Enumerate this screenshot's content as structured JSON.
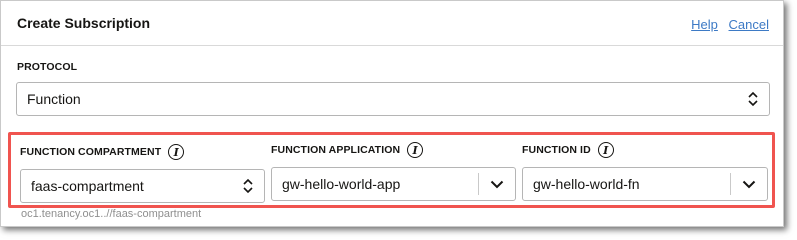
{
  "dialog": {
    "title": "Create Subscription",
    "help_label": "Help",
    "cancel_label": "Cancel"
  },
  "protocol": {
    "label": "PROTOCOL",
    "value": "Function"
  },
  "function_compartment": {
    "label": "FUNCTION COMPARTMENT",
    "value": "faas-compartment",
    "info_icon": "i"
  },
  "function_application": {
    "label": "FUNCTION APPLICATION",
    "value": "gw-hello-world-app",
    "info_icon": "i"
  },
  "function_id": {
    "label": "FUNCTION ID",
    "value": "gw-hello-world-fn",
    "info_icon": "i"
  },
  "faint_text": "oc1.tenancy.oc1..//faas-compartment",
  "colors": {
    "link": "#3d7ac5",
    "highlight": "#f0544f",
    "text": "#161513",
    "border": "#b5b5b5"
  },
  "icons": [
    "info-icon",
    "chevron-down-icon",
    "up-down-chevron-icon"
  ]
}
